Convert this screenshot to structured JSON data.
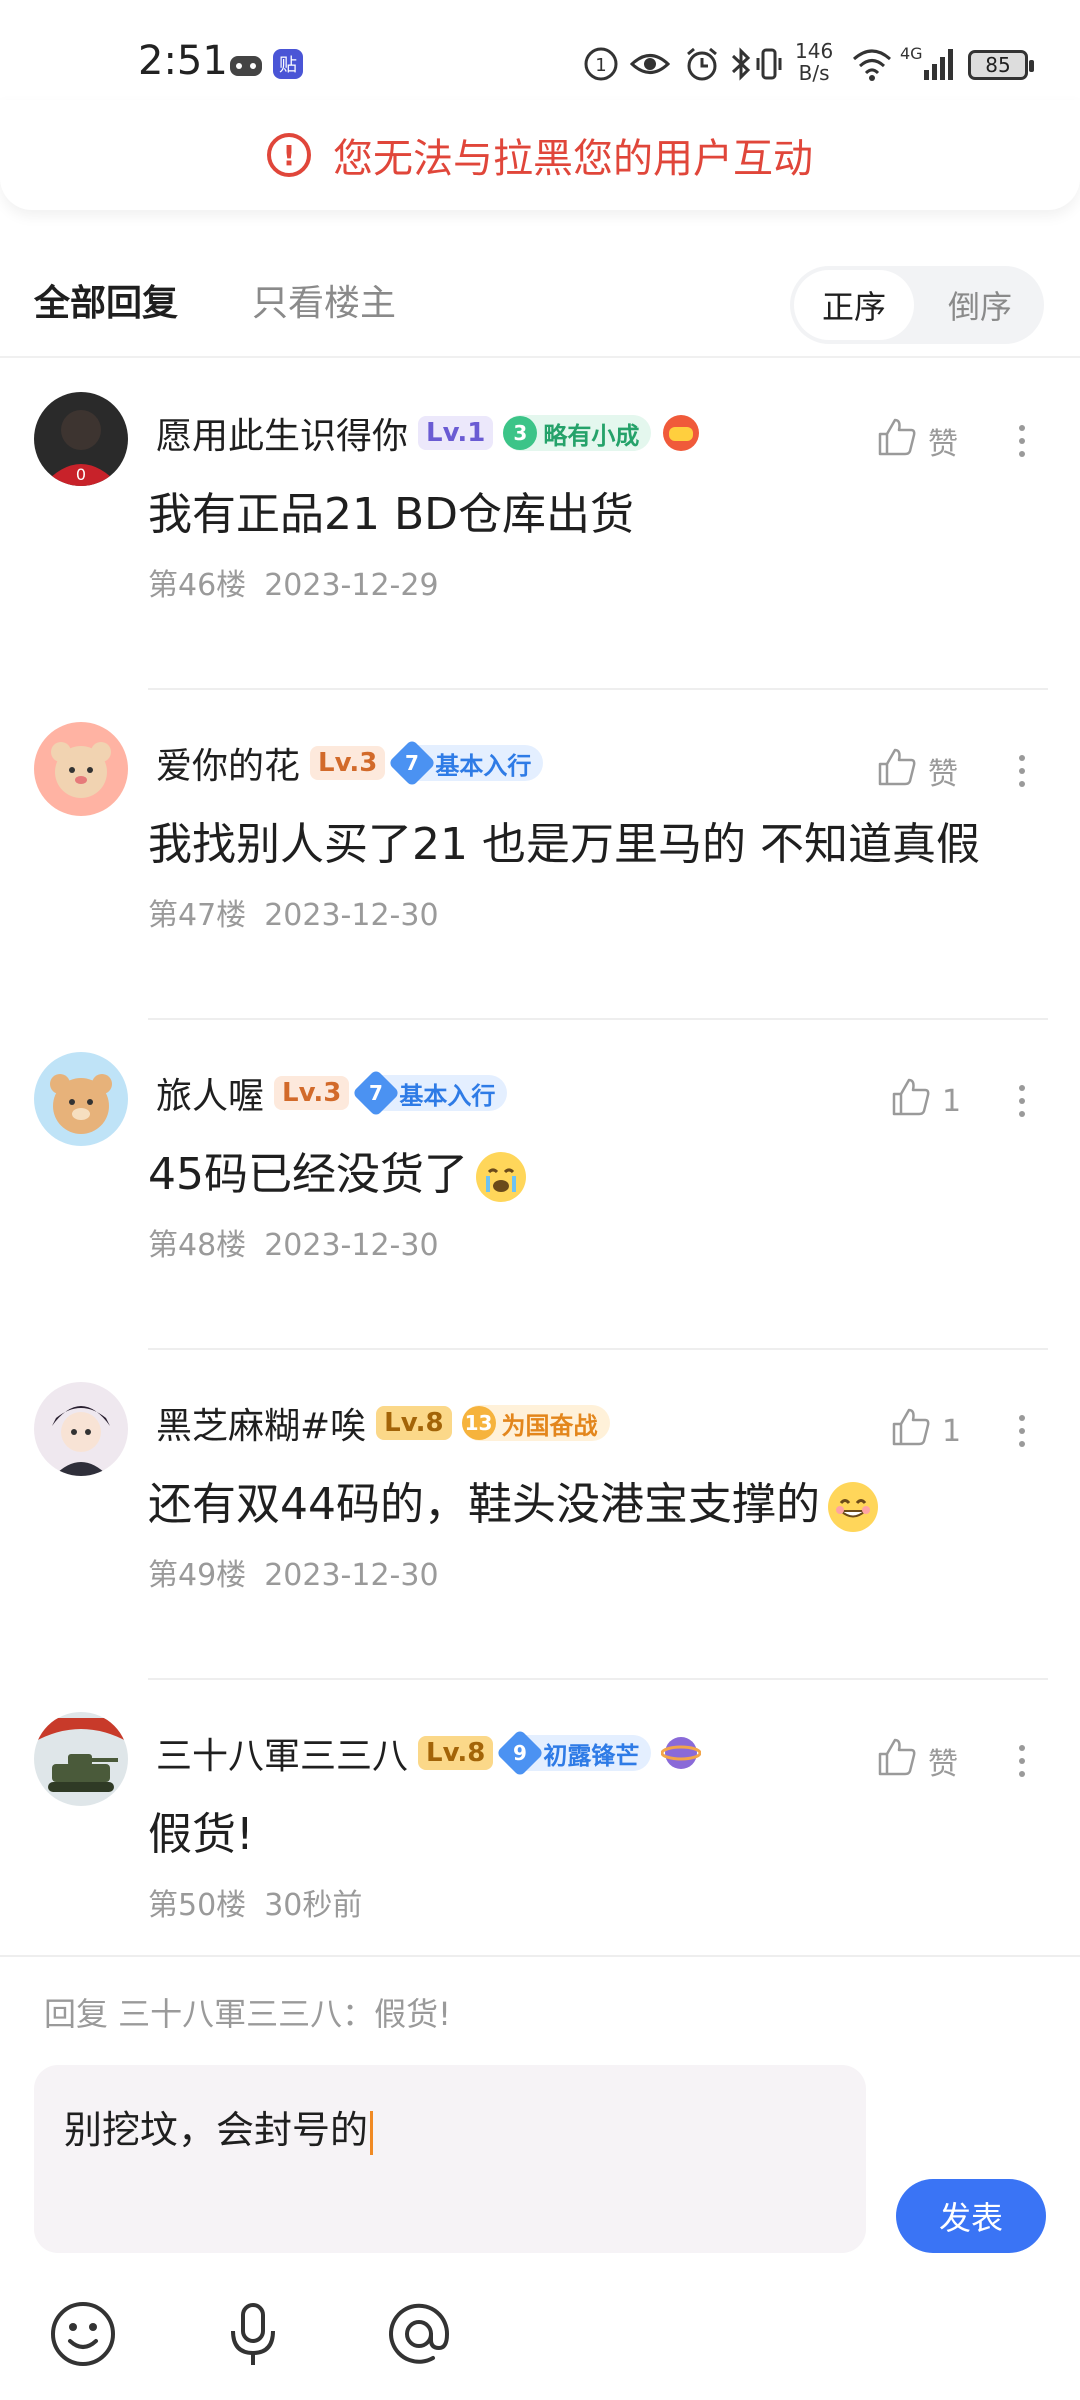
{
  "status_bar": {
    "time": "2:51",
    "net_speed_value": "146",
    "net_speed_unit": "B/s",
    "network": "4G",
    "battery": "85"
  },
  "toast": {
    "text": "您无法与拉黑您的用户互动",
    "color": "#e0463a"
  },
  "tabs": {
    "all": "全部回复",
    "host_only": "只看楼主",
    "sort_asc": "正序",
    "sort_desc": "倒序"
  },
  "posts": [
    {
      "username": "愿用此生识得你",
      "level": "Lv.1",
      "badge_num": "3",
      "badge_text": "略有小成",
      "likes": "赞",
      "content": "我有正品21 BD仓库出货",
      "floor": "第46楼",
      "date": "2023-12-29"
    },
    {
      "username": "爱你的花",
      "level": "Lv.3",
      "badge_num": "7",
      "badge_text": "基本入行",
      "likes": "赞",
      "content": "我找别人买了21 也是万里马的 不知道真假",
      "floor": "第47楼",
      "date": "2023-12-30"
    },
    {
      "username": "旅人喔",
      "level": "Lv.3",
      "badge_num": "7",
      "badge_text": "基本入行",
      "likes": "1",
      "content": "45码已经没货了",
      "floor": "第48楼",
      "date": "2023-12-30"
    },
    {
      "username": "黑芝麻糊#唉",
      "level": "Lv.8",
      "badge_num": "13",
      "badge_text": "为国奋战",
      "likes": "1",
      "content": "还有双44码的，鞋头没港宝支撑的",
      "floor": "第49楼",
      "date": "2023-12-30"
    },
    {
      "username": "三十八軍三三八",
      "level": "Lv.8",
      "badge_num": "9",
      "badge_text": "初露锋芒",
      "likes": "赞",
      "content": "假货!",
      "floor": "第50楼",
      "date": "30秒前"
    }
  ],
  "reply": {
    "hint": "回复 三十八軍三三八：假货!",
    "input_value": "别挖坟，会封号的",
    "send_label": "发表"
  },
  "colors": {
    "accent": "#3a74f5",
    "error": "#e0463a"
  },
  "icons": [
    "emoji-icon",
    "microphone-icon",
    "at-icon",
    "thumb-up-icon",
    "more-vertical-icon"
  ]
}
